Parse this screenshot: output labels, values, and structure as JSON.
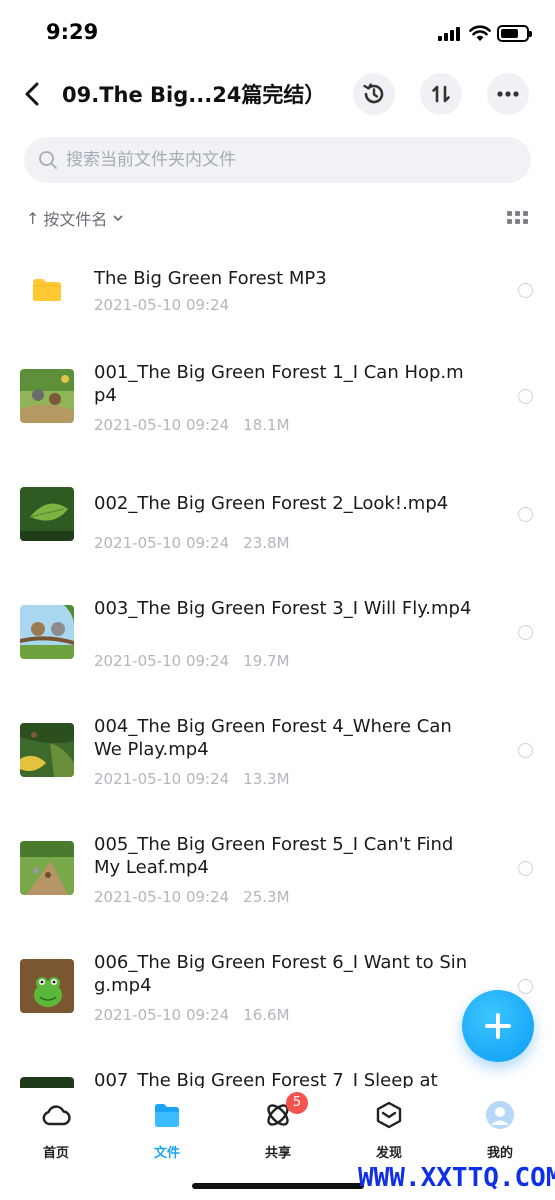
{
  "status_bar": {
    "time": "9:29"
  },
  "nav": {
    "title": "09.The Big...24篇完结）"
  },
  "search": {
    "placeholder": "搜索当前文件夹内文件"
  },
  "sort": {
    "label": "按文件名",
    "arrow": "↑"
  },
  "files": [
    {
      "name": "The Big Green Forest MP3",
      "date": "2021-05-10 09:24",
      "size": "",
      "type": "folder"
    },
    {
      "name": "001_The Big Green Forest 1_I Can Hop.mp4",
      "date": "2021-05-10 09:24",
      "size": "18.1M",
      "type": "video"
    },
    {
      "name": "002_The Big Green Forest 2_Look!.mp4",
      "date": "2021-05-10 09:24",
      "size": "23.8M",
      "type": "video"
    },
    {
      "name": "003_The Big Green Forest 3_I Will Fly.mp4",
      "date": "2021-05-10 09:24",
      "size": "19.7M",
      "type": "video"
    },
    {
      "name": "004_The Big Green Forest 4_Where Can We Play.mp4",
      "date": "2021-05-10 09:24",
      "size": "13.3M",
      "type": "video"
    },
    {
      "name": "005_The Big Green Forest 5_I Can't Find My Leaf.mp4",
      "date": "2021-05-10 09:24",
      "size": "25.3M",
      "type": "video"
    },
    {
      "name": "006_The Big Green Forest 6_I Want to Sing.mp4",
      "date": "2021-05-10 09:24",
      "size": "16.6M",
      "type": "video"
    },
    {
      "name": "007_The Big Green Forest 7_I Sleep at",
      "date": "",
      "size": "",
      "type": "video"
    }
  ],
  "tabs": [
    {
      "label": "首页",
      "icon": "cloud-icon",
      "active": false
    },
    {
      "label": "文件",
      "icon": "folder-icon",
      "active": true
    },
    {
      "label": "共享",
      "icon": "orbit-icon",
      "active": false,
      "badge": "5"
    },
    {
      "label": "发现",
      "icon": "cube-icon",
      "active": false
    },
    {
      "label": "我的",
      "icon": "avatar-icon",
      "active": false
    }
  ],
  "watermark": "WWW.XXTTQ.COM",
  "colors": {
    "accent": "#1aa4f5",
    "folder": "#ffc933",
    "badge": "#f5534d"
  }
}
